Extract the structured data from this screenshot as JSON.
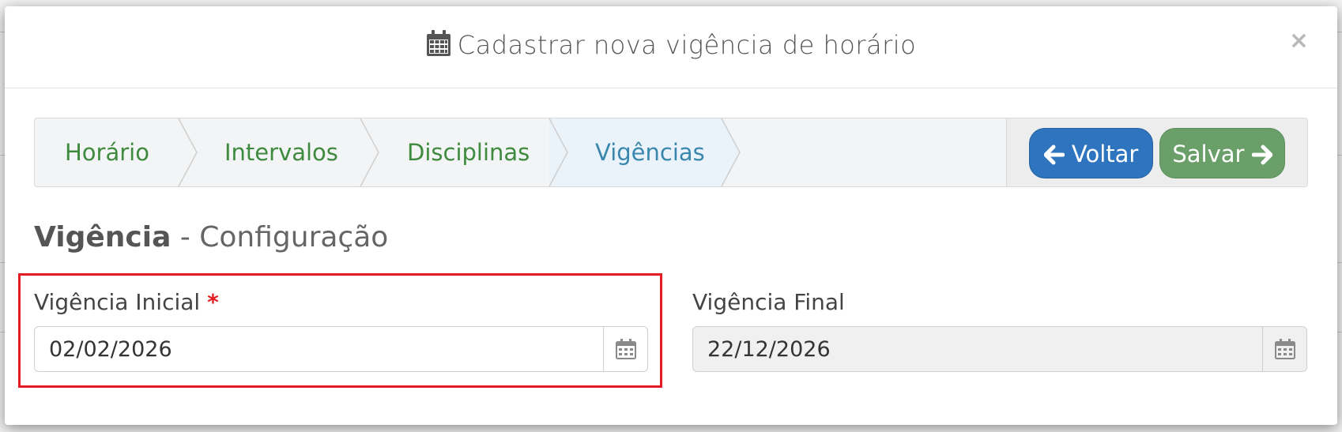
{
  "modal": {
    "title": "Cadastrar nova vigência de horário",
    "close_label": "×"
  },
  "wizard": {
    "steps": [
      {
        "label": "Horário"
      },
      {
        "label": "Intervalos"
      },
      {
        "label": "Disciplinas"
      },
      {
        "label": "Vigências",
        "active": true
      }
    ],
    "back_label": "Voltar",
    "save_label": "Salvar"
  },
  "section": {
    "title_bold": "Vigência",
    "title_rest": "- Configuração"
  },
  "fields": {
    "start": {
      "label": "Vigência Inicial",
      "required_mark": "*",
      "value": "02/02/2026"
    },
    "end": {
      "label": "Vigência Final",
      "value": "22/12/2026"
    }
  },
  "colors": {
    "primary": "#2f74bf",
    "success": "#6a9f6a",
    "step_text": "#3e8a3e",
    "step_active": "#3a87ad",
    "highlight": "#e31b23"
  },
  "icons": [
    "calendar-icon",
    "close-icon",
    "arrow-left-icon",
    "arrow-right-icon"
  ]
}
